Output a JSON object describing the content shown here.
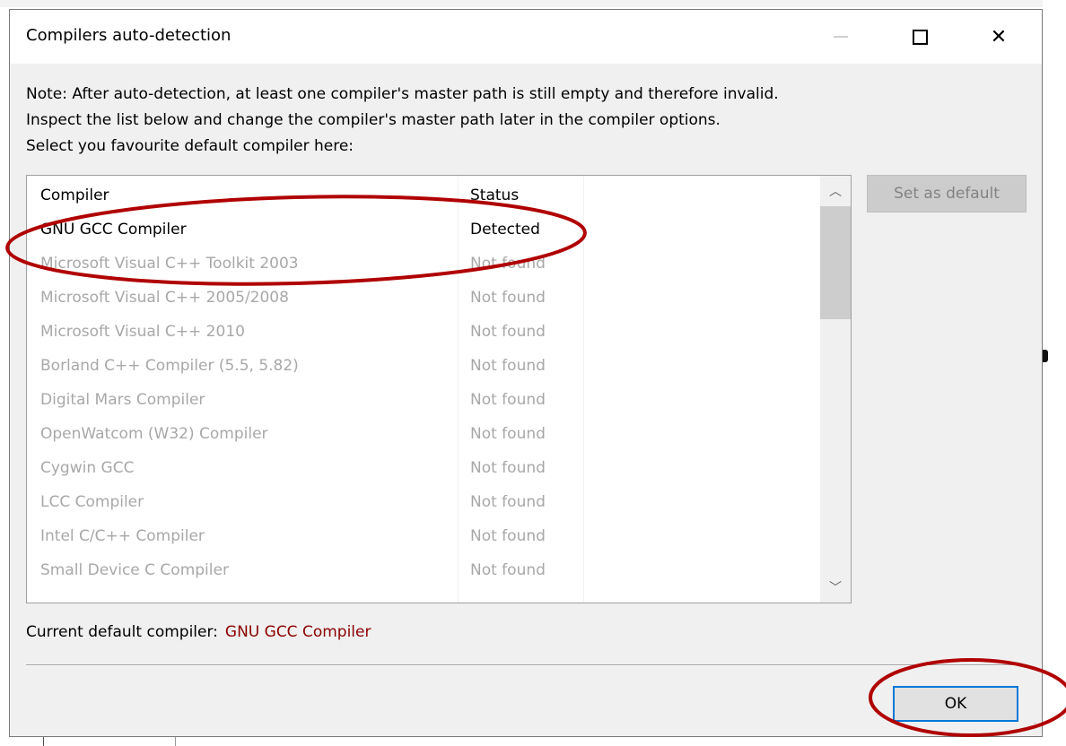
{
  "window": {
    "title": "Compilers auto-detection",
    "minimize_icon": "minimize-icon",
    "maximize_icon": "maximize-icon",
    "close_icon": "close-icon",
    "close_glyph": "✕"
  },
  "note": {
    "lines": [
      "Note: After auto-detection, at least one compiler's master path is still empty and therefore invalid.",
      "Inspect the list below and change the compiler's master path later in the compiler options.",
      "Select you favourite default compiler here:"
    ]
  },
  "list": {
    "headers": {
      "compiler": "Compiler",
      "status": "Status"
    },
    "rows": [
      {
        "name": "GNU GCC Compiler",
        "status": "Detected",
        "enabled": true
      },
      {
        "name": "Microsoft Visual C++ Toolkit 2003",
        "status": "Not found",
        "enabled": false
      },
      {
        "name": "Microsoft Visual C++ 2005/2008",
        "status": "Not found",
        "enabled": false
      },
      {
        "name": "Microsoft Visual C++ 2010",
        "status": "Not found",
        "enabled": false
      },
      {
        "name": "Borland C++ Compiler (5.5, 5.82)",
        "status": "Not found",
        "enabled": false
      },
      {
        "name": "Digital Mars Compiler",
        "status": "Not found",
        "enabled": false
      },
      {
        "name": "OpenWatcom (W32) Compiler",
        "status": "Not found",
        "enabled": false
      },
      {
        "name": "Cygwin GCC",
        "status": "Not found",
        "enabled": false
      },
      {
        "name": "LCC Compiler",
        "status": "Not found",
        "enabled": false
      },
      {
        "name": "Intel C/C++ Compiler",
        "status": "Not found",
        "enabled": false
      },
      {
        "name": "Small Device C Compiler",
        "status": "Not found",
        "enabled": false
      }
    ],
    "scroll_up_glyph": "︿",
    "scroll_down_glyph": "﹀"
  },
  "buttons": {
    "set_default": "Set as default",
    "ok": "OK"
  },
  "current_default": {
    "label": "Current default compiler:",
    "value": "GNU GCC Compiler"
  },
  "colors": {
    "annotation": "#b00000",
    "current_default_value": "#8b0000",
    "ok_focus_border": "#0078d7"
  }
}
